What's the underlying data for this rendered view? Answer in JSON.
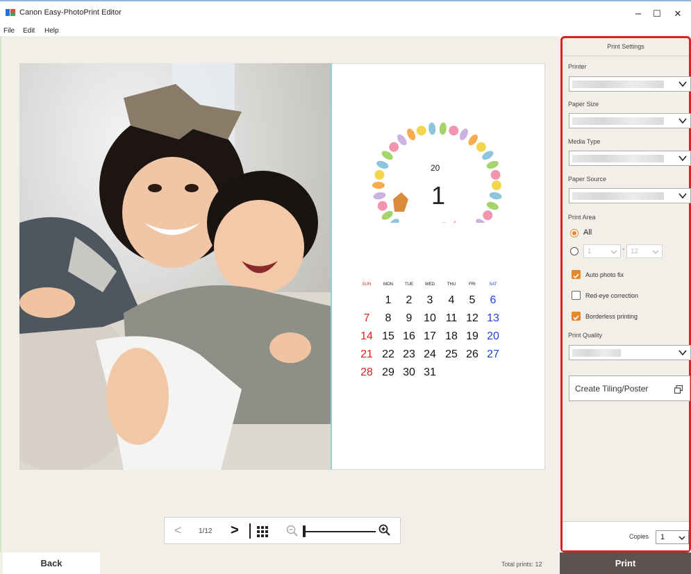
{
  "app": {
    "title": "Canon Easy-PhotoPrint Editor",
    "window_controls": {
      "minimize": "–",
      "maximize": "☐",
      "close": "✕"
    }
  },
  "menu": [
    "File",
    "Edit",
    "Help"
  ],
  "calendar": {
    "year": "20",
    "month": "1",
    "weekdays": [
      "SUN",
      "MON",
      "TUE",
      "WED",
      "THU",
      "FRI",
      "SAT"
    ],
    "weeks": [
      [
        "",
        "1",
        "2",
        "3",
        "4",
        "5",
        "6"
      ],
      [
        "7",
        "8",
        "9",
        "10",
        "11",
        "12",
        "13"
      ],
      [
        "14",
        "15",
        "16",
        "17",
        "18",
        "19",
        "20"
      ],
      [
        "21",
        "22",
        "23",
        "24",
        "25",
        "26",
        "27"
      ],
      [
        "28",
        "29",
        "30",
        "31",
        "",
        "",
        ""
      ]
    ],
    "colors": {
      "sunday": "#e0201a",
      "saturday": "#1f3fd8",
      "weekday": "#111111"
    }
  },
  "navigation": {
    "page_indicator": "1/12"
  },
  "footer": {
    "back_label": "Back",
    "total_prints": "Total prints: 12",
    "print_label": "Print"
  },
  "print_settings": {
    "title": "Print Settings",
    "printer_label": "Printer",
    "paper_size_label": "Paper Size",
    "media_type_label": "Media Type",
    "paper_source_label": "Paper Source",
    "print_area_label": "Print Area",
    "print_area_all": "All",
    "range_from": "1",
    "range_to": "12",
    "range_separator": "-",
    "auto_photo_fix": {
      "label": "Auto photo fix",
      "checked": true
    },
    "red_eye_correction": {
      "label": "Red-eye correction",
      "checked": false
    },
    "borderless_printing": {
      "label": "Borderless printing",
      "checked": true
    },
    "print_quality_label": "Print Quality",
    "create_tiling_label": "Create Tiling/Poster",
    "copies_label": "Copies",
    "copies_value": "1"
  },
  "accent_colors": {
    "highlight_border": "#e02020",
    "checkbox": "#e8862a",
    "print_button": "#5e5151"
  }
}
